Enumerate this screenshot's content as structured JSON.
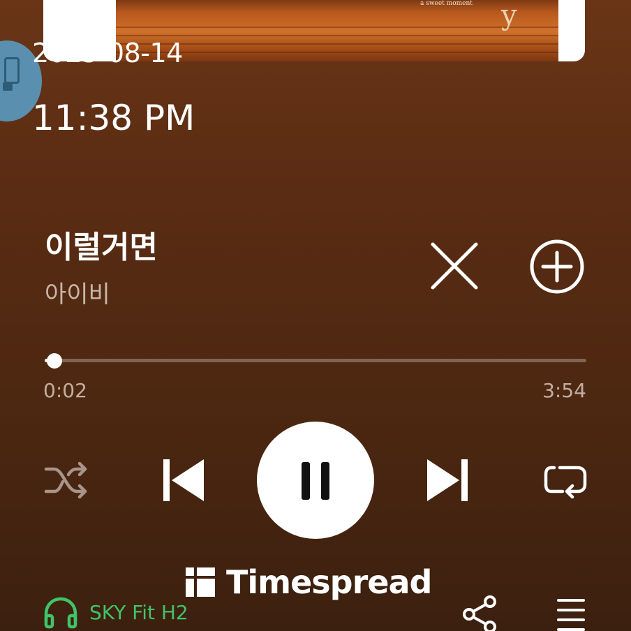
{
  "status": {
    "date": "2025-08-14",
    "time": "11:38 PM"
  },
  "album_art": {
    "text_line": "a sweet moment",
    "letter": "y"
  },
  "track": {
    "title": "이럴거면",
    "artist": "아이비"
  },
  "playback": {
    "elapsed": "0:02",
    "duration": "3:54",
    "progress_fraction": 0.0085,
    "state": "playing"
  },
  "controls": {
    "shuffle_icon": "shuffle-icon",
    "prev_icon": "skip-previous-icon",
    "play_icon": "pause-icon",
    "next_icon": "skip-next-icon",
    "repeat_icon": "repeat-icon",
    "close_icon": "close-icon",
    "add_icon": "add-circle-icon"
  },
  "watermark": {
    "text": "Timespread"
  },
  "footer": {
    "device_name": "SKY Fit H2",
    "device_icon": "headphones-icon",
    "share_icon": "share-icon",
    "queue_icon": "queue-icon"
  },
  "colors": {
    "background_top": "#6a3516",
    "background_bottom": "#3c200f",
    "device_accent": "#3fc46a",
    "secondary_text": "#c2aea1"
  }
}
